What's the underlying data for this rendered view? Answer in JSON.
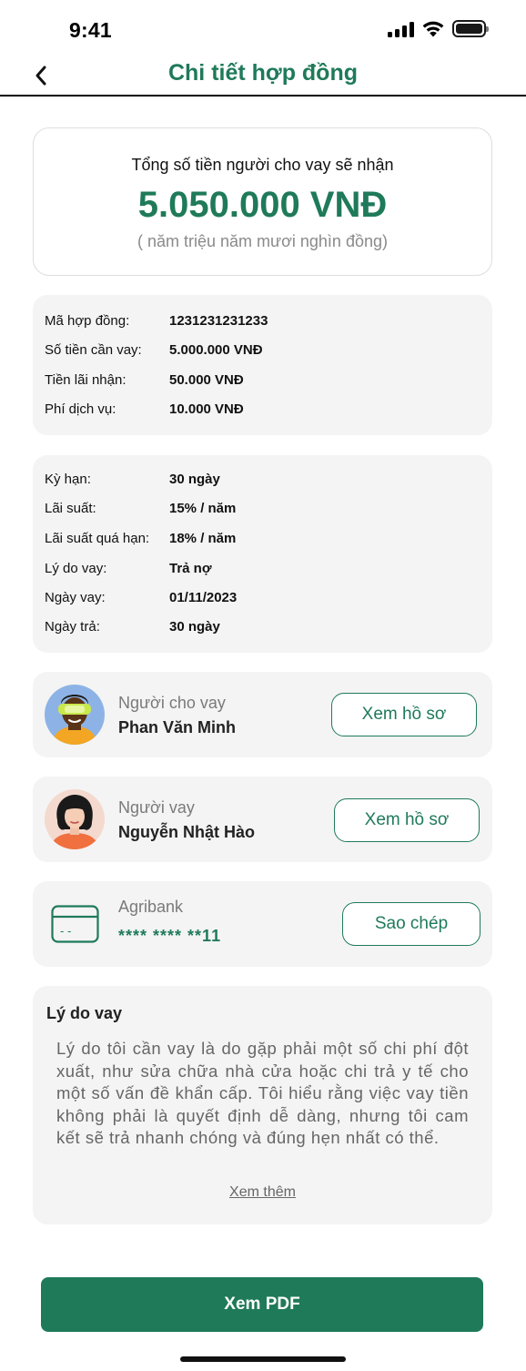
{
  "status_bar": {
    "time": "9:41"
  },
  "header": {
    "title": "Chi tiết hợp đồng"
  },
  "summary": {
    "label": "Tổng số tiền người cho vay sẽ nhận",
    "amount": "5.050.000 VNĐ",
    "amount_words": "( năm triệu năm mươi nghìn đồng)"
  },
  "contract_info": [
    {
      "label": "Mã hợp đồng:",
      "value": "1231231231233"
    },
    {
      "label": "Số tiền cần vay:",
      "value": "5.000.000 VNĐ"
    },
    {
      "label": "Tiền lãi nhận:",
      "value": "50.000 VNĐ"
    },
    {
      "label": "Phí dịch vụ:",
      "value": "10.000 VNĐ"
    }
  ],
  "loan_terms": [
    {
      "label": "Kỳ hạn:",
      "value": "30 ngày"
    },
    {
      "label": "Lãi suất:",
      "value": "15% / năm"
    },
    {
      "label": "Lãi suất quá hạn:",
      "value": "18% / năm"
    },
    {
      "label": "Lý do vay:",
      "value": "Trả nợ"
    },
    {
      "label": "Ngày vay:",
      "value": "01/11/2023"
    },
    {
      "label": "Ngày trả:",
      "value": "30 ngày"
    }
  ],
  "lender": {
    "role": "Người cho vay",
    "name": "Phan Văn Minh",
    "button": "Xem hồ sơ"
  },
  "borrower": {
    "role": "Người vay",
    "name": "Nguyễn Nhật Hào",
    "button": "Xem hồ sơ"
  },
  "bank": {
    "name": "Agribank",
    "account": "**** **** **11",
    "card_chip": "- -",
    "button": "Sao chép"
  },
  "reason": {
    "title": "Lý do vay",
    "text": "Lý do tôi cần vay là do gặp phải một số chi phí đột xuất, như sửa chữa nhà cửa hoặc chi trả y tế cho một số vấn đề khẩn cấp. Tôi hiểu rằng việc vay tiền không phải là quyết định dễ dàng, nhưng tôi cam kết sẽ trả nhanh chóng và đúng hẹn nhất có thể.",
    "read_more": "Xem thêm"
  },
  "actions": {
    "view_pdf": "Xem PDF"
  },
  "colors": {
    "brand": "#1f7a5a",
    "card_bg": "#f4f4f4",
    "muted_text": "#7a7a7a"
  },
  "icons": [
    "back-arrow-icon",
    "signal-icon",
    "wifi-icon",
    "battery-icon",
    "bank-card-icon"
  ]
}
